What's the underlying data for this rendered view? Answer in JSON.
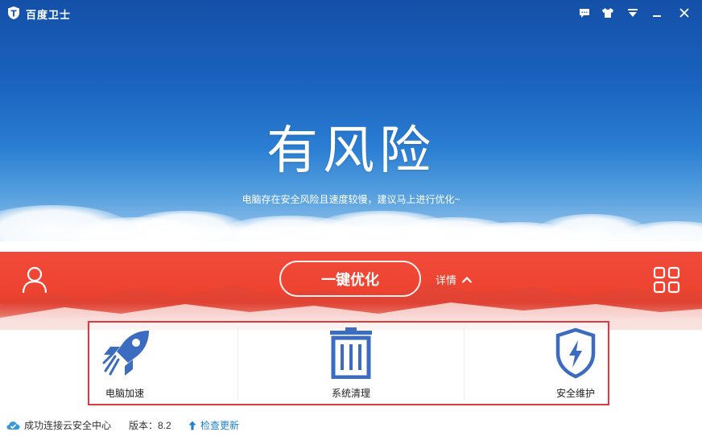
{
  "window": {
    "title": "百度卫士"
  },
  "titlebar": {
    "buttons": [
      {
        "icon": "feedback-icon"
      },
      {
        "icon": "skin-icon"
      },
      {
        "icon": "menu-icon"
      },
      {
        "icon": "minimize-icon"
      },
      {
        "icon": "close-icon"
      }
    ]
  },
  "hero": {
    "headline": "有风险",
    "subtitle": "电脑存在安全风险且速度较慢，建议马上进行优化~"
  },
  "actions": {
    "optimize_label": "一键优化",
    "details_label": "详情"
  },
  "tools": [
    {
      "label": "电脑加速",
      "icon": "rocket-icon"
    },
    {
      "label": "系统清理",
      "icon": "trash-icon"
    },
    {
      "label": "安全维护",
      "icon": "shield-icon"
    }
  ],
  "status": {
    "connection": "成功连接云安全中心",
    "version": "版本：8.2",
    "update": "检查更新"
  },
  "colors": {
    "sky": "#1a63bf",
    "band": "#ee4331",
    "highlight_border": "#e03a3a",
    "tool_icon": "#3b6cbf",
    "link": "#1e7fd0"
  }
}
